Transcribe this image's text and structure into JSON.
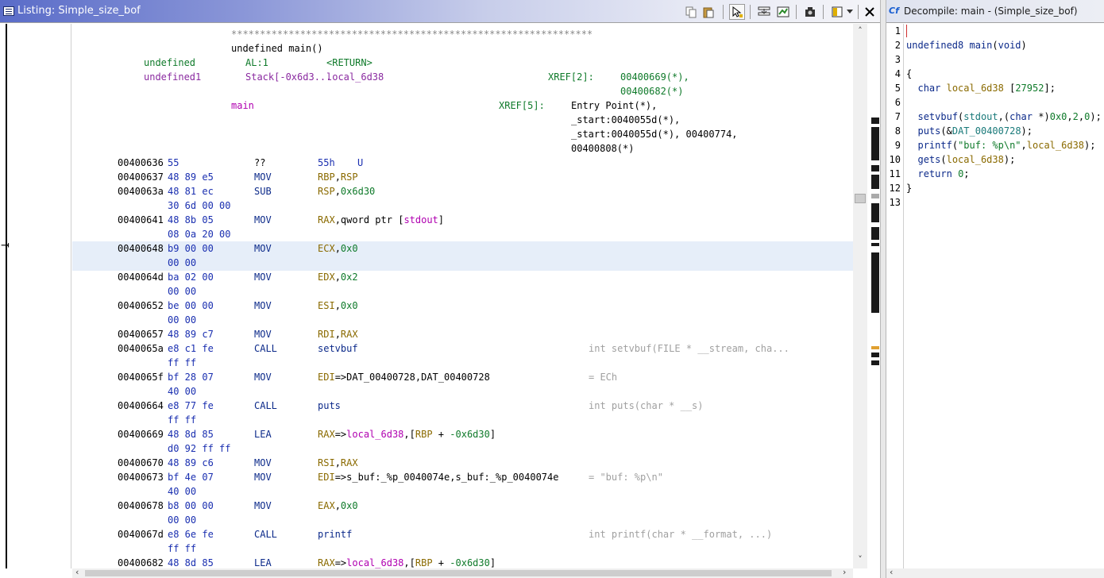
{
  "listing": {
    "title": "Listing:  Simple_size_bof",
    "toolbar_icons": [
      "copy-icon",
      "paste-icon",
      "cursor-select-icon",
      "insert-row-icon",
      "diff-icon",
      "snapshot-icon",
      "layout-icon",
      "dropdown-icon",
      "close-icon"
    ],
    "header": {
      "stars": "***************************************************************",
      "signature": "undefined main()",
      "params": [
        {
          "type": "undefined",
          "storage": "AL:1",
          "name": "<RETURN>"
        },
        {
          "type": "undefined1",
          "storage": "Stack[-0x6d3...",
          "name": "local_6d38",
          "xref_label": "XREF[2]:",
          "xrefs": [
            "00400669(*),",
            "00400682(*)"
          ]
        }
      ],
      "label": "main",
      "label_xref_label": "XREF[5]:",
      "label_xrefs": [
        "Entry Point(*),",
        "_start:0040055d(*),",
        "_start:0040055d(*), 00400774,",
        "00400808(*)"
      ]
    },
    "rows": [
      {
        "addr": "00400636",
        "bytes": "55",
        "bytes2": "",
        "mnem": "??",
        "operands": "55h",
        "extra": "U",
        "comment": ""
      },
      {
        "addr": "00400637",
        "bytes": "48 89 e5",
        "bytes2": "",
        "mnem": "MOV",
        "operands": "RBP,RSP",
        "comment": ""
      },
      {
        "addr": "0040063a",
        "bytes": "48 81 ec",
        "bytes2": "30 6d 00 00",
        "mnem": "SUB",
        "operands": "RSP,0x6d30",
        "comment": ""
      },
      {
        "addr": "00400641",
        "bytes": "48 8b 05",
        "bytes2": "08 0a 20 00",
        "mnem": "MOV",
        "operands": "RAX,qword ptr [stdout]",
        "comment": ""
      },
      {
        "addr": "00400648",
        "bytes": "b9 00 00",
        "bytes2": "00 00",
        "mnem": "MOV",
        "operands": "ECX,0x0",
        "comment": ""
      },
      {
        "addr": "0040064d",
        "bytes": "ba 02 00",
        "bytes2": "00 00",
        "mnem": "MOV",
        "operands": "EDX,0x2",
        "comment": ""
      },
      {
        "addr": "00400652",
        "bytes": "be 00 00",
        "bytes2": "00 00",
        "mnem": "MOV",
        "operands": "ESI,0x0",
        "comment": ""
      },
      {
        "addr": "00400657",
        "bytes": "48 89 c7",
        "bytes2": "",
        "mnem": "MOV",
        "operands": "RDI,RAX",
        "comment": ""
      },
      {
        "addr": "0040065a",
        "bytes": "e8 c1 fe",
        "bytes2": "ff ff",
        "mnem": "CALL",
        "operands": "setvbuf",
        "comment": "int setvbuf(FILE * __stream, cha..."
      },
      {
        "addr": "0040065f",
        "bytes": "bf 28 07",
        "bytes2": "40 00",
        "mnem": "MOV",
        "operands": "EDI=>DAT_00400728,DAT_00400728",
        "comment": "= ECh"
      },
      {
        "addr": "00400664",
        "bytes": "e8 77 fe",
        "bytes2": "ff ff",
        "mnem": "CALL",
        "operands": "puts",
        "comment": "int puts(char * __s)"
      },
      {
        "addr": "00400669",
        "bytes": "48 8d 85",
        "bytes2": "d0 92 ff ff",
        "mnem": "LEA",
        "operands": "RAX=>local_6d38,[RBP + -0x6d30]",
        "comment": ""
      },
      {
        "addr": "00400670",
        "bytes": "48 89 c6",
        "bytes2": "",
        "mnem": "MOV",
        "operands": "RSI,RAX",
        "comment": ""
      },
      {
        "addr": "00400673",
        "bytes": "bf 4e 07",
        "bytes2": "40 00",
        "mnem": "MOV",
        "operands": "EDI=>s_buf:_%p_0040074e,s_buf:_%p_0040074e",
        "comment": "= \"buf: %p\\n\""
      },
      {
        "addr": "00400678",
        "bytes": "b8 00 00",
        "bytes2": "00 00",
        "mnem": "MOV",
        "operands": "EAX,0x0",
        "comment": ""
      },
      {
        "addr": "0040067d",
        "bytes": "e8 6e fe",
        "bytes2": "ff ff",
        "mnem": "CALL",
        "operands": "printf",
        "comment": "int printf(char * __format, ...)"
      },
      {
        "addr": "00400682",
        "bytes": "48 8d 85",
        "bytes2": "",
        "mnem": "LEA",
        "operands": "RAX=>local_6d38,[RBP + -0x6d30]",
        "comment": ""
      }
    ]
  },
  "decompile": {
    "title": "Decompile: main -  (Simple_size_bof)",
    "icon_text": "Cf",
    "line_numbers": [
      "1",
      "2",
      "3",
      "4",
      "5",
      "6",
      "7",
      "8",
      "9",
      "10",
      "11",
      "12",
      "13"
    ],
    "lines": [
      "",
      "undefined8 main(void)",
      "",
      "{",
      "  char local_6d38 [27952];",
      "",
      "  setvbuf(stdout,(char *)0x0,2,0);",
      "  puts(&DAT_00400728);",
      "  printf(\"buf: %p\\n\",local_6d38);",
      "  gets(local_6d38);",
      "  return 0;",
      "}",
      ""
    ]
  }
}
